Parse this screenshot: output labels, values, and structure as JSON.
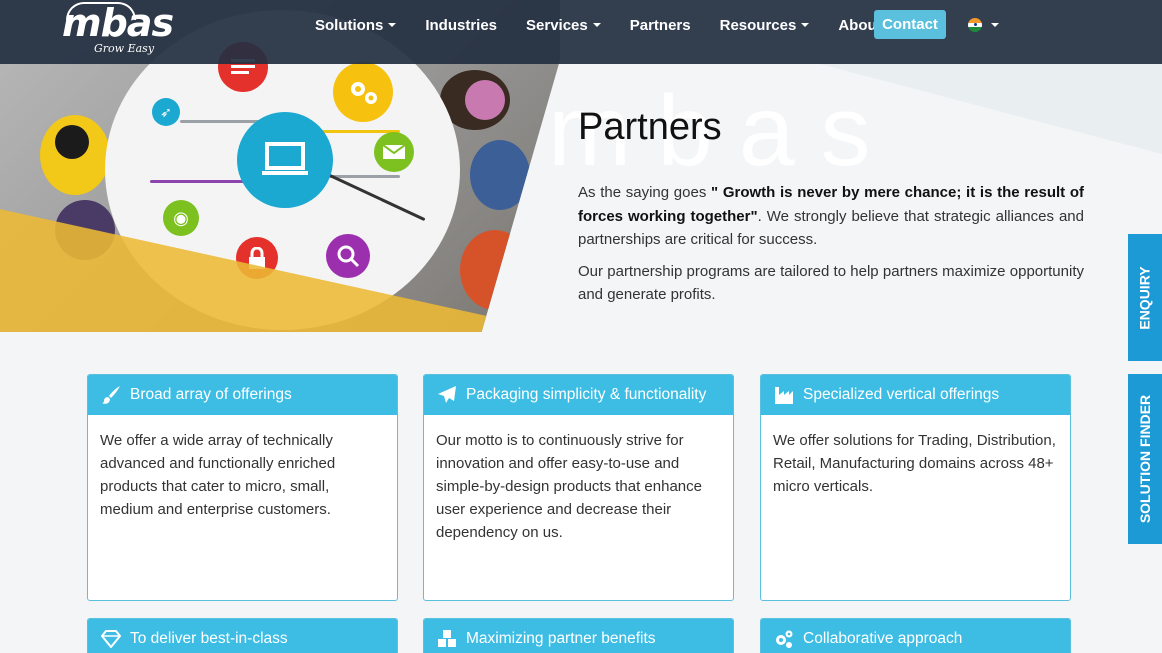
{
  "header": {
    "logo_text": "mbas",
    "logo_tagline": "Grow Easy",
    "nav": [
      {
        "label": "Solutions",
        "dropdown": true
      },
      {
        "label": "Industries",
        "dropdown": false
      },
      {
        "label": "Services",
        "dropdown": true
      },
      {
        "label": "Partners",
        "dropdown": false
      },
      {
        "label": "Resources",
        "dropdown": true
      },
      {
        "label": "About",
        "dropdown": true
      }
    ],
    "contact_label": "Contact",
    "language_icon": "india-flag-icon"
  },
  "hero": {
    "watermark": "mbas",
    "title": "Partners",
    "intro_prefix": "As the saying goes ",
    "intro_quote": "\" Growth is never by mere chance; it is the result of forces working together\"",
    "intro_suffix": ". We strongly believe that strategic alliances and partnerships are critical for success.",
    "intro_2": "Our partnership programs are tailored to help partners maximize opportunity and generate profits."
  },
  "side_tabs": {
    "enquiry": "ENQUIRY",
    "solution_finder": "SOLUTION FINDER"
  },
  "cards": [
    {
      "icon": "paintbrush-icon",
      "title": "Broad array of offerings",
      "body": "We offer a wide array of technically advanced and functionally enriched products that cater to micro, small, medium and enterprise customers."
    },
    {
      "icon": "paper-plane-icon",
      "title": "Packaging simplicity & functionality",
      "body": "Our motto is to continuously strive for innovation and offer easy-to-use and simple-by-design products that enhance user experience and decrease their dependency on us."
    },
    {
      "icon": "industry-icon",
      "title": "Specialized vertical offerings",
      "body": "We offer solutions for Trading, Distribution, Retail, Manufacturing domains across 48+ micro verticals."
    },
    {
      "icon": "diamond-icon",
      "title": "To deliver best-in-class",
      "body": ""
    },
    {
      "icon": "cubes-icon",
      "title": "Maximizing partner benefits",
      "body": ""
    },
    {
      "icon": "gears-icon",
      "title": "Collaborative approach",
      "body": ""
    }
  ],
  "colors": {
    "navbar": "#242f42",
    "accent": "#3dbde4",
    "contact_button": "#5bc0de",
    "side_tab": "#1b9ad6",
    "hero_yellow": "#ecba34"
  }
}
